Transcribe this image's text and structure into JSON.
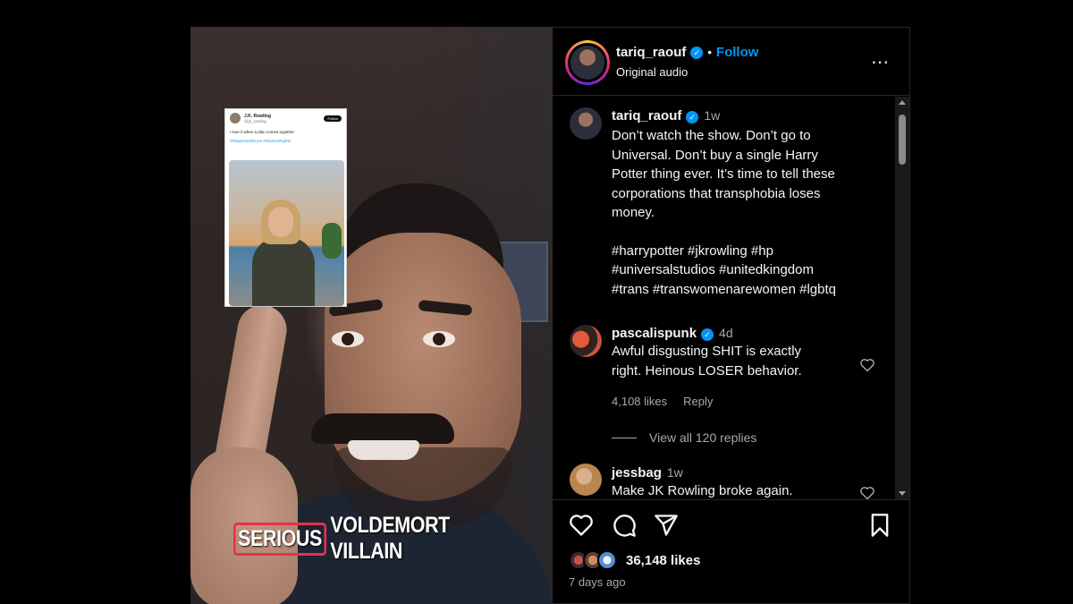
{
  "video": {
    "caption_highlight": "SERIOUS",
    "caption_rest": "VOLDEMORT VILLAIN",
    "tweet": {
      "name": "J.K. Rowling",
      "handle": "@jk_rowling",
      "follow": "Follow",
      "text": "I love it when a plan comes together.",
      "tags": "#ShapeOutOfLine #WomenRights"
    }
  },
  "post_header": {
    "username": "tariq_raouf",
    "separator": "•",
    "follow_label": "Follow",
    "audio": "Original audio",
    "more_icon": "⋯"
  },
  "caption_comment": {
    "username": "tariq_raouf",
    "time": "1w",
    "text_lines": [
      "Don’t watch the show. Don’t go to",
      "Universal. Don’t buy a single Harry",
      "Potter thing ever. It’s time to tell these",
      "corporations that transphobia loses",
      "money."
    ],
    "hashtag_lines": [
      "#harrypotter #jkrowling #hp",
      "#universalstudios #unitedkingdom",
      "#trans #transwomenarewomen #lgbtq"
    ]
  },
  "comments": [
    {
      "username": "pascalispunk",
      "verified": true,
      "time": "4d",
      "text_lines": [
        "Awful disgusting SHIT is exactly",
        "right. Heinous LOSER behavior."
      ],
      "likes": "4,108 likes",
      "reply_label": "Reply",
      "view_replies": "View all 120 replies"
    },
    {
      "username": "jessbag",
      "verified": false,
      "time": "1w",
      "text_lines": [
        "Make JK Rowling broke again."
      ]
    }
  ],
  "actions": {
    "icons": [
      "heart-icon",
      "comment-icon",
      "share-icon",
      "bookmark-icon"
    ],
    "likes": "36,148 likes",
    "posted": "7 days ago"
  },
  "colors": {
    "accent": "#0095f6",
    "caption_highlight_border": "#e8304f",
    "secondary_text": "#a8a8a8"
  }
}
